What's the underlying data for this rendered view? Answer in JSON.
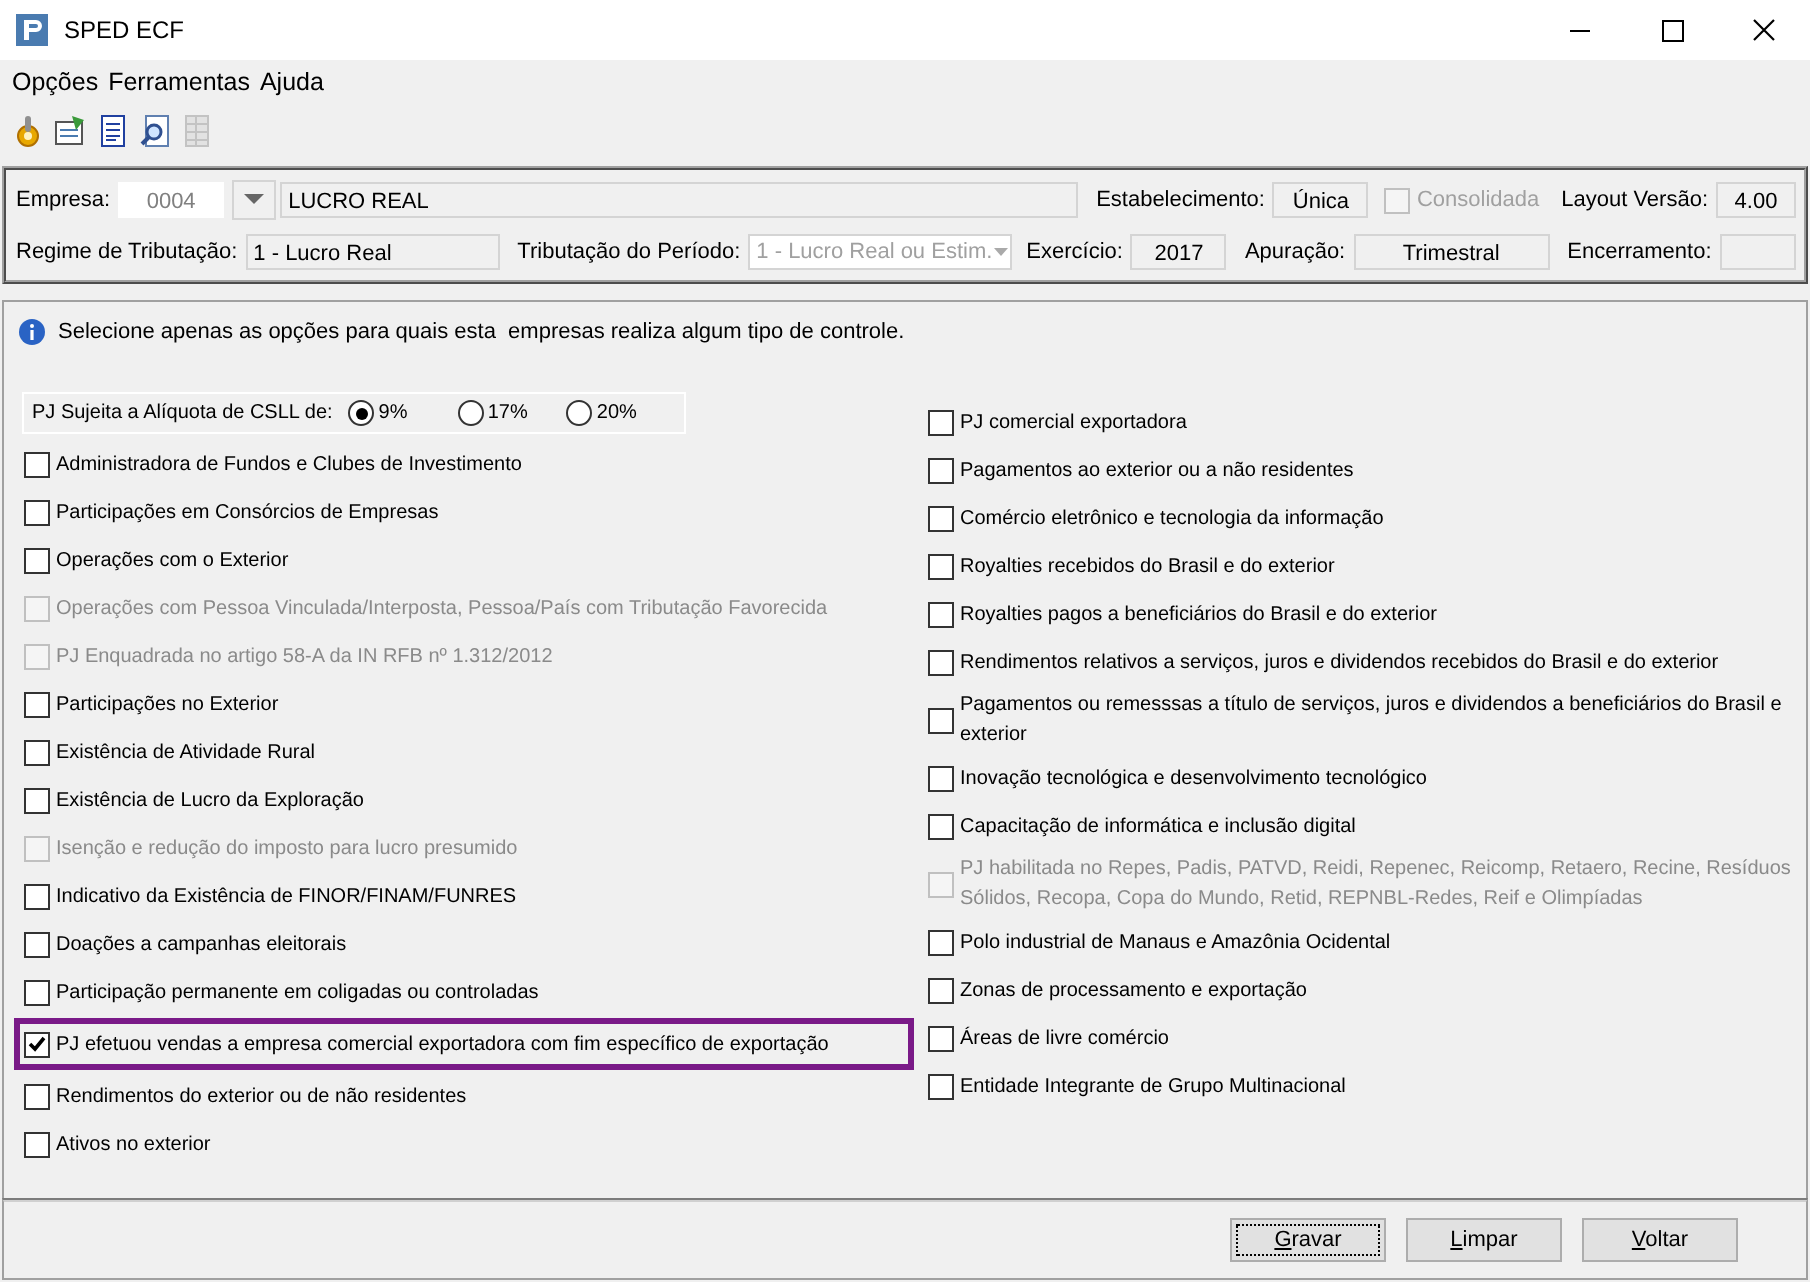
{
  "window": {
    "title": "SPED ECF"
  },
  "menu": [
    "Opções",
    "Ferramentas",
    "Ajuda"
  ],
  "toolbar": [
    {
      "kind": "gear",
      "disabled": false
    },
    {
      "kind": "form",
      "disabled": false
    },
    {
      "kind": "document",
      "disabled": false
    },
    {
      "kind": "search",
      "disabled": false
    },
    {
      "kind": "grid",
      "disabled": true
    }
  ],
  "header": [
    [
      {
        "kind": "label",
        "text": "Empresa:"
      },
      {
        "kind": "code",
        "value": "0004"
      },
      {
        "kind": "dropdown"
      },
      {
        "kind": "field",
        "value": "LUCRO REAL"
      },
      {
        "kind": "label",
        "text": "Estabelecimento:"
      },
      {
        "kind": "field",
        "value": "Única"
      },
      {
        "kind": "checkbox",
        "text": "Consolidada",
        "checked": false,
        "disabled": true
      },
      {
        "kind": "label",
        "text": "Layout Versão:"
      },
      {
        "kind": "field",
        "value": "4.00"
      }
    ],
    [
      {
        "kind": "label",
        "text": "Regime de Tributação:"
      },
      {
        "kind": "field",
        "value": "1 - Lucro Real"
      },
      {
        "kind": "label",
        "text": "Tributação do Período:"
      },
      {
        "kind": "select",
        "value": "1 - Lucro Real ou Estim.",
        "disabled": true
      },
      {
        "kind": "label",
        "text": "Exercício:"
      },
      {
        "kind": "field",
        "value": "2017"
      },
      {
        "kind": "label",
        "text": "Apuração:"
      },
      {
        "kind": "field",
        "value": "Trimestral"
      },
      {
        "kind": "label",
        "text": "Encerramento:"
      },
      {
        "kind": "field"
      }
    ]
  ],
  "info": "Selecione apenas as opções para quais esta  empresas realiza algum tipo de controle.",
  "csll": {
    "label": "PJ Sujeita a Alíquota de CSLL de:",
    "options": [
      {
        "label": "9%",
        "selected": true
      },
      {
        "label": "17%",
        "selected": false
      },
      {
        "label": "20%",
        "selected": false
      }
    ]
  },
  "left_options": [
    {
      "label": "Administradora de Fundos e Clubes de Investimento",
      "checked": false,
      "disabled": false,
      "highlighted": false
    },
    {
      "label": "Participações em Consórcios de Empresas",
      "checked": false,
      "disabled": false,
      "highlighted": false
    },
    {
      "label": "Operações com o Exterior",
      "checked": false,
      "disabled": false,
      "highlighted": false
    },
    {
      "label": "Operações com Pessoa Vinculada/Interposta, Pessoa/País com Tributação Favorecida",
      "checked": false,
      "disabled": true,
      "highlighted": false
    },
    {
      "label": "PJ Enquadrada no artigo 58-A da IN RFB nº 1.312/2012",
      "checked": false,
      "disabled": true,
      "highlighted": false
    },
    {
      "label": "Participações no Exterior",
      "checked": false,
      "disabled": false,
      "highlighted": false
    },
    {
      "label": "Existência de Atividade Rural",
      "checked": false,
      "disabled": false,
      "highlighted": false
    },
    {
      "label": "Existência de Lucro da Exploração",
      "checked": false,
      "disabled": false,
      "highlighted": false
    },
    {
      "label": "Isenção e redução do imposto para lucro presumido",
      "checked": false,
      "disabled": true,
      "highlighted": false
    },
    {
      "label": "Indicativo da Existência de FINOR/FINAM/FUNRES",
      "checked": false,
      "disabled": false,
      "highlighted": false
    },
    {
      "label": "Doações a campanhas eleitorais",
      "checked": false,
      "disabled": false,
      "highlighted": false
    },
    {
      "label": "Participação permanente em coligadas ou controladas",
      "checked": false,
      "disabled": false,
      "highlighted": false
    },
    {
      "label": "PJ efetuou vendas a empresa comercial exportadora com fim específico de exportação",
      "checked": true,
      "disabled": false,
      "highlighted": true
    },
    {
      "label": "Rendimentos do exterior ou de não residentes",
      "checked": false,
      "disabled": false,
      "highlighted": false
    },
    {
      "label": "Ativos no exterior",
      "checked": false,
      "disabled": false,
      "highlighted": false
    }
  ],
  "right_options": [
    {
      "label": "PJ comercial exportadora",
      "checked": false,
      "disabled": false
    },
    {
      "label": "Pagamentos ao exterior ou a não residentes",
      "checked": false,
      "disabled": false
    },
    {
      "label": "Comércio eletrônico e tecnologia da informação",
      "checked": false,
      "disabled": false
    },
    {
      "label": "Royalties recebidos do Brasil e do exterior",
      "checked": false,
      "disabled": false
    },
    {
      "label": "Royalties pagos a beneficiários do Brasil e do exterior",
      "checked": false,
      "disabled": false
    },
    {
      "label": "Rendimentos relativos a serviços, juros e dividendos recebidos do Brasil e do exterior",
      "checked": false,
      "disabled": false
    },
    {
      "label": "Pagamentos ou remesssas a título de serviços, juros e dividendos a beneficiários do Brasil e exterior",
      "checked": false,
      "disabled": false
    },
    {
      "label": "Inovação tecnológica e desenvolvimento tecnológico",
      "checked": false,
      "disabled": false
    },
    {
      "label": "Capacitação de informática e inclusão digital",
      "checked": false,
      "disabled": false
    },
    {
      "label": "PJ habilitada no Repes, Padis, PATVD, Reidi, Repenec, Reicomp, Retaero, Recine, Resíduos Sólidos, Recopa, Copa do Mundo, Retid, REPNBL-Redes, Reif e Olimpíadas",
      "checked": false,
      "disabled": true
    },
    {
      "label": "Polo industrial de Manaus e Amazônia Ocidental",
      "checked": false,
      "disabled": false
    },
    {
      "label": "Zonas de processamento e exportação",
      "checked": false,
      "disabled": false
    },
    {
      "label": "Áreas de livre comércio",
      "checked": false,
      "disabled": false
    },
    {
      "label": "Entidade Integrante de Grupo Multinacional",
      "checked": false,
      "disabled": false
    }
  ],
  "buttons": [
    {
      "label": "Gravar",
      "focused": true
    },
    {
      "label": "Limpar",
      "focused": false
    },
    {
      "label": "Voltar",
      "focused": false
    }
  ]
}
